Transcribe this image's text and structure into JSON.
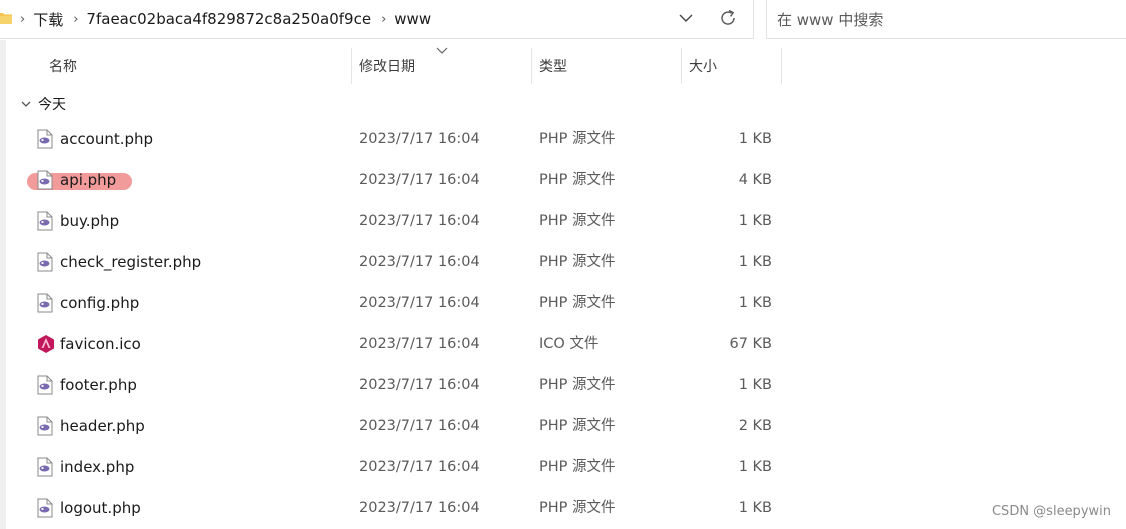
{
  "address_bar": {
    "breadcrumbs": [
      "下载",
      "7faeac02baca4f829872c8a250a0f9ce",
      "www"
    ]
  },
  "search": {
    "placeholder": "在 www 中搜索"
  },
  "columns": {
    "name": "名称",
    "date": "修改日期",
    "type": "类型",
    "size": "大小"
  },
  "group": {
    "label": "今天"
  },
  "files": [
    {
      "name": "account.php",
      "date": "2023/7/17 16:04",
      "type": "PHP 源文件",
      "size": "1 KB",
      "icon": "php-file-icon"
    },
    {
      "name": "api.php",
      "date": "2023/7/17 16:04",
      "type": "PHP 源文件",
      "size": "4 KB",
      "icon": "php-file-icon",
      "highlighted": true
    },
    {
      "name": "buy.php",
      "date": "2023/7/17 16:04",
      "type": "PHP 源文件",
      "size": "1 KB",
      "icon": "php-file-icon"
    },
    {
      "name": "check_register.php",
      "date": "2023/7/17 16:04",
      "type": "PHP 源文件",
      "size": "1 KB",
      "icon": "php-file-icon"
    },
    {
      "name": "config.php",
      "date": "2023/7/17 16:04",
      "type": "PHP 源文件",
      "size": "1 KB",
      "icon": "php-file-icon"
    },
    {
      "name": "favicon.ico",
      "date": "2023/7/17 16:04",
      "type": "ICO 文件",
      "size": "67 KB",
      "icon": "ico-file-icon"
    },
    {
      "name": "footer.php",
      "date": "2023/7/17 16:04",
      "type": "PHP 源文件",
      "size": "1 KB",
      "icon": "php-file-icon"
    },
    {
      "name": "header.php",
      "date": "2023/7/17 16:04",
      "type": "PHP 源文件",
      "size": "2 KB",
      "icon": "php-file-icon"
    },
    {
      "name": "index.php",
      "date": "2023/7/17 16:04",
      "type": "PHP 源文件",
      "size": "1 KB",
      "icon": "php-file-icon"
    },
    {
      "name": "logout.php",
      "date": "2023/7/17 16:04",
      "type": "PHP 源文件",
      "size": "1 KB",
      "icon": "php-file-icon"
    }
  ],
  "watermark": "CSDN @sleepywin",
  "colors": {
    "highlight": "#f29b9b",
    "folder": "#f4c44e",
    "php_icon": "#7a6bb0",
    "ico_icon": "#c2185b"
  }
}
